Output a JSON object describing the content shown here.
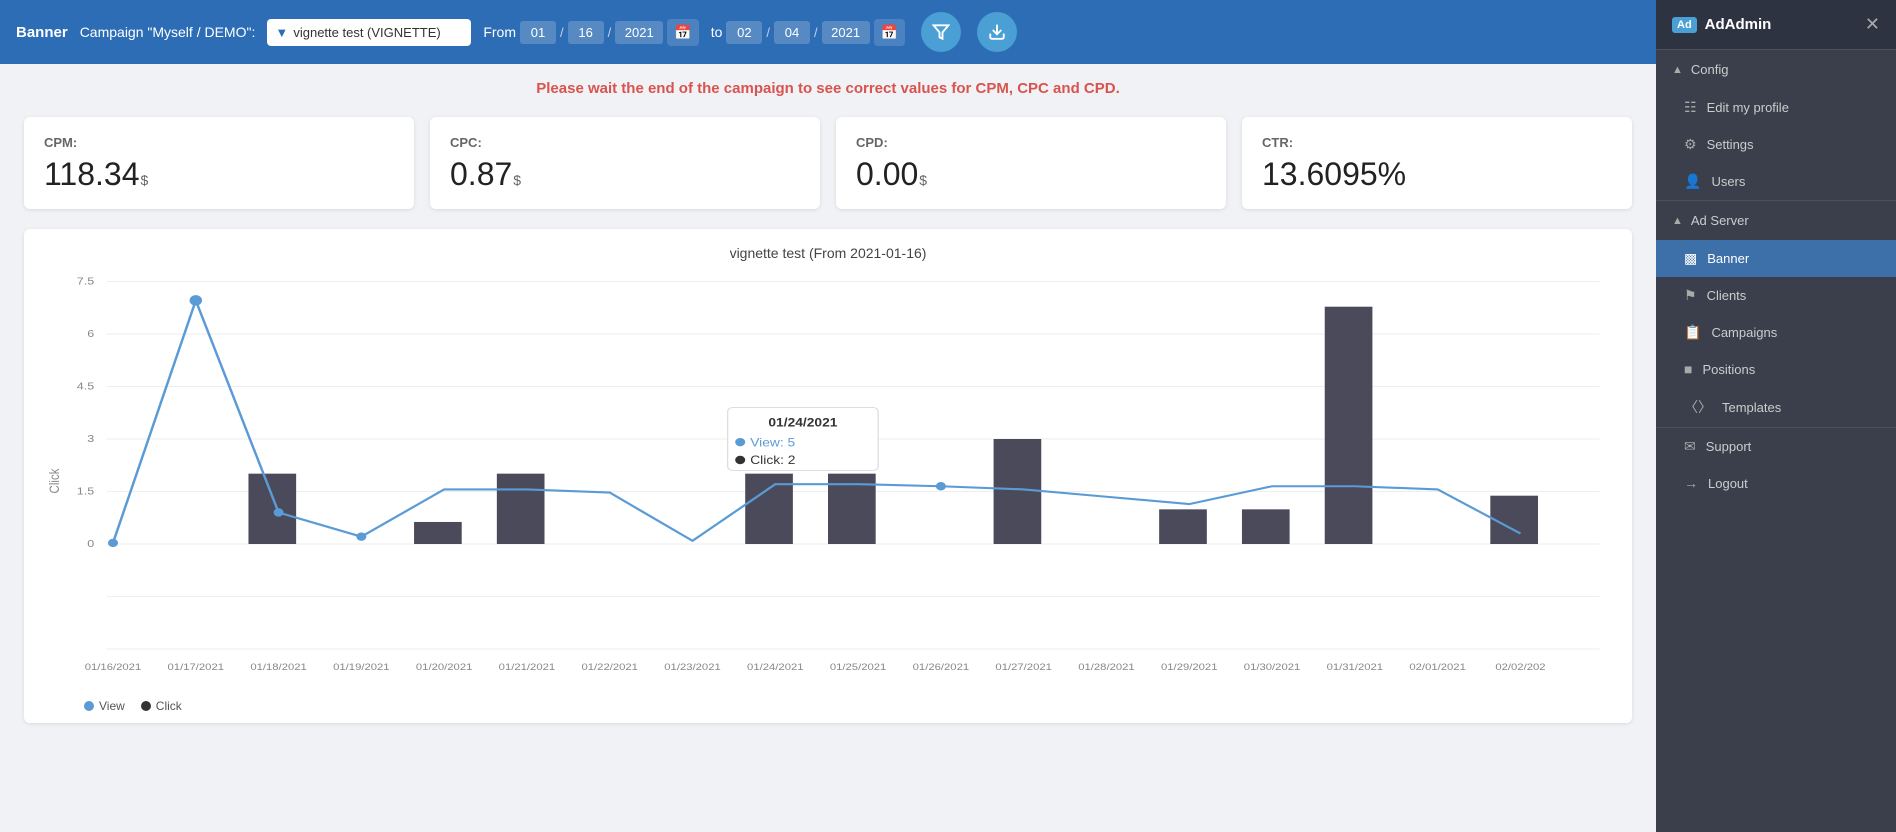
{
  "header": {
    "breadcrumb": "Banner",
    "campaign_label": "Campaign \"Myself / DEMO\":",
    "campaign_option": "vignette test (VIGNETTE)",
    "from_label": "From",
    "to_label": "to",
    "from_month": "01",
    "from_day": "16",
    "from_year": "2021",
    "to_month": "02",
    "to_day": "04",
    "to_year": "2021"
  },
  "warning": {
    "text": "Please wait the end of the campaign to see correct values for CPM, CPC and CPD."
  },
  "metrics": [
    {
      "label": "CPM:",
      "value": "118.34",
      "unit": "$"
    },
    {
      "label": "CPC:",
      "value": "0.87",
      "unit": "$"
    },
    {
      "label": "CPD:",
      "value": "0.00",
      "unit": "$"
    },
    {
      "label": "CTR:",
      "value": "13.6095%",
      "unit": ""
    }
  ],
  "chart": {
    "title": "vignette test (From 2021-01-16)",
    "y_axis_label": "Click",
    "y_ticks": [
      "7.5",
      "6",
      "4.5",
      "3",
      "1.5",
      "0"
    ],
    "x_labels": [
      "01/16/2021",
      "01/17/2021",
      "01/18/2021",
      "01/19/2021",
      "01/20/2021",
      "01/21/2021",
      "01/22/2021",
      "01/23/2021",
      "01/24/2021",
      "01/25/2021",
      "01/26/2021",
      "01/27/2021",
      "01/28/2021",
      "01/29/2021",
      "01/30/2021",
      "01/31/2021",
      "02/01/2021",
      "02/02/202"
    ],
    "legend_view": "View",
    "legend_click": "Click",
    "tooltip": {
      "date": "01/24/2021",
      "view_label": "View:",
      "view_value": "5",
      "click_label": "Click:",
      "click_value": "2"
    }
  },
  "sidebar": {
    "app_badge": "Ad",
    "app_name": "AdAdmin",
    "sections": [
      {
        "label": "Config",
        "collapsible": true,
        "items": []
      }
    ],
    "items": [
      {
        "id": "edit-profile",
        "icon": "&#9783;",
        "label": "Edit my profile"
      },
      {
        "id": "settings",
        "icon": "&#9881;",
        "label": "Settings"
      },
      {
        "id": "users",
        "icon": "&#128100;",
        "label": "Users"
      }
    ],
    "ad_server_label": "Ad Server",
    "ad_server_items": [
      {
        "id": "banner",
        "icon": "&#9641;",
        "label": "Banner",
        "active": true
      },
      {
        "id": "clients",
        "icon": "&#9873;",
        "label": "Clients"
      },
      {
        "id": "campaigns",
        "icon": "&#128203;",
        "label": "Campaigns"
      },
      {
        "id": "positions",
        "icon": "&#9632;",
        "label": "Positions"
      },
      {
        "id": "templates",
        "icon": "&#9001;",
        "label": "Templates"
      }
    ],
    "bottom_items": [
      {
        "id": "support",
        "icon": "&#9993;",
        "label": "Support"
      },
      {
        "id": "logout",
        "icon": "&#8594;",
        "label": "Logout"
      }
    ],
    "close_label": "&#10005;"
  }
}
